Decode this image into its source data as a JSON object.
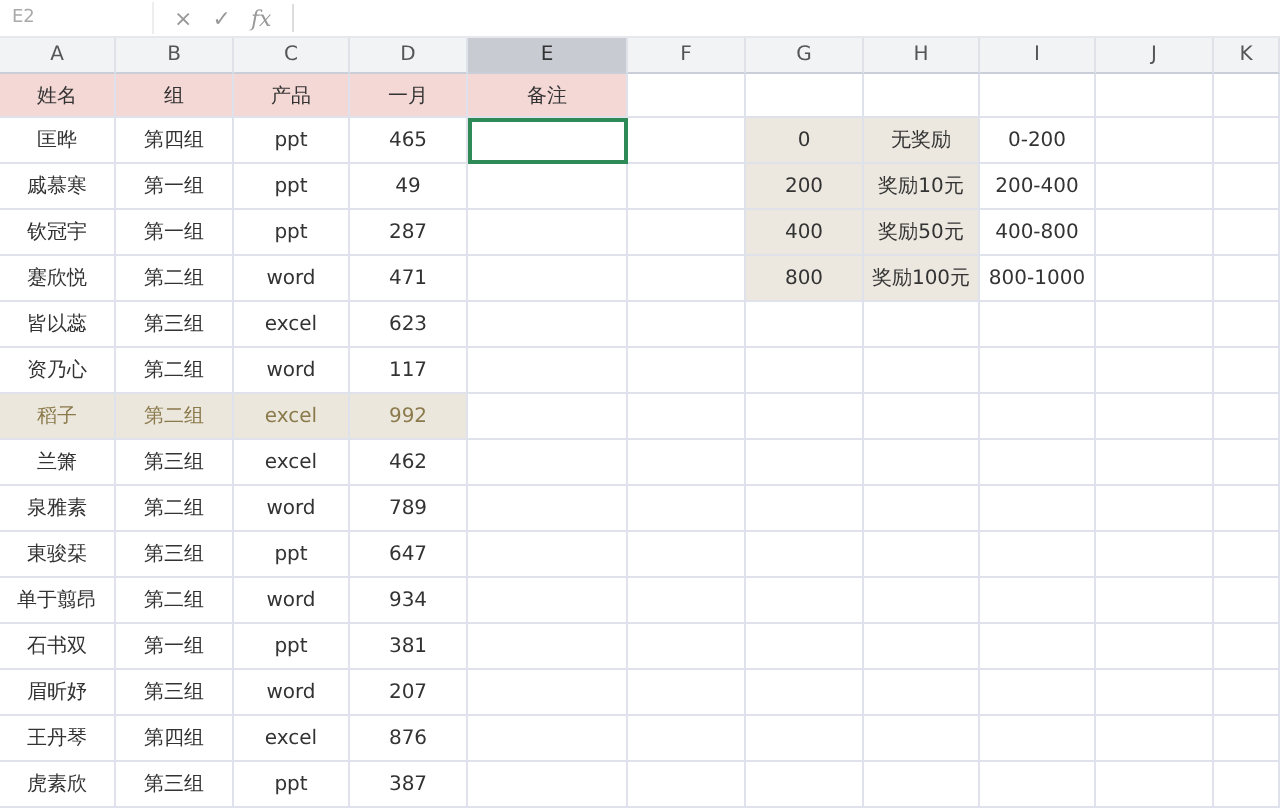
{
  "formula_bar": {
    "cell_ref": "E2",
    "cancel": "×",
    "confirm": "✓",
    "function": "fx"
  },
  "column_headers": [
    {
      "label": "A",
      "selected": false
    },
    {
      "label": "B",
      "selected": false
    },
    {
      "label": "C",
      "selected": false
    },
    {
      "label": "D",
      "selected": false
    },
    {
      "label": "E",
      "selected": true
    },
    {
      "label": "F",
      "selected": false
    },
    {
      "label": "G",
      "selected": false
    },
    {
      "label": "H",
      "selected": false
    },
    {
      "label": "I",
      "selected": false
    },
    {
      "label": "J",
      "selected": false
    },
    {
      "label": "K",
      "selected": false
    }
  ],
  "table": {
    "columns": [
      "姓名",
      "组",
      "产品",
      "一月",
      "备注"
    ],
    "rows": [
      {
        "cells": [
          "匡晔",
          "第四组",
          "ppt",
          "465"
        ],
        "highlighted": false,
        "note_selected": true
      },
      {
        "cells": [
          "戚慕寒",
          "第一组",
          "ppt",
          "49"
        ],
        "highlighted": false,
        "note_selected": false
      },
      {
        "cells": [
          "钦冠宇",
          "第一组",
          "ppt",
          "287"
        ],
        "highlighted": false,
        "note_selected": false
      },
      {
        "cells": [
          "蹇欣悦",
          "第二组",
          "word",
          "471"
        ],
        "highlighted": false,
        "note_selected": false
      },
      {
        "cells": [
          "皆以蕊",
          "第三组",
          "excel",
          "623"
        ],
        "highlighted": false,
        "note_selected": false
      },
      {
        "cells": [
          "资乃心",
          "第二组",
          "word",
          "117"
        ],
        "highlighted": false,
        "note_selected": false
      },
      {
        "cells": [
          "稻子",
          "第二组",
          "excel",
          "992"
        ],
        "highlighted": true,
        "note_selected": false
      },
      {
        "cells": [
          "兰箫",
          "第三组",
          "excel",
          "462"
        ],
        "highlighted": false,
        "note_selected": false
      },
      {
        "cells": [
          "泉雅素",
          "第二组",
          "word",
          "789"
        ],
        "highlighted": false,
        "note_selected": false
      },
      {
        "cells": [
          "東骏栞",
          "第三组",
          "ppt",
          "647"
        ],
        "highlighted": false,
        "note_selected": false
      },
      {
        "cells": [
          "单于翦昂",
          "第二组",
          "word",
          "934"
        ],
        "highlighted": false,
        "note_selected": false
      },
      {
        "cells": [
          "石书双",
          "第一组",
          "ppt",
          "381"
        ],
        "highlighted": false,
        "note_selected": false
      },
      {
        "cells": [
          "眉昕妤",
          "第三组",
          "word",
          "207"
        ],
        "highlighted": false,
        "note_selected": false
      },
      {
        "cells": [
          "王丹琴",
          "第四组",
          "excel",
          "876"
        ],
        "highlighted": false,
        "note_selected": false
      },
      {
        "cells": [
          "虎素欣",
          "第三组",
          "ppt",
          "387"
        ],
        "highlighted": false,
        "note_selected": false
      }
    ]
  },
  "reward_table": [
    {
      "threshold": "0",
      "reward": "无奖励",
      "range": "0-200"
    },
    {
      "threshold": "200",
      "reward": "奖励10元",
      "range": "200-400"
    },
    {
      "threshold": "400",
      "reward": "奖励50元",
      "range": "400-800"
    },
    {
      "threshold": "800",
      "reward": "奖励100元",
      "range": "800-1000"
    }
  ]
}
